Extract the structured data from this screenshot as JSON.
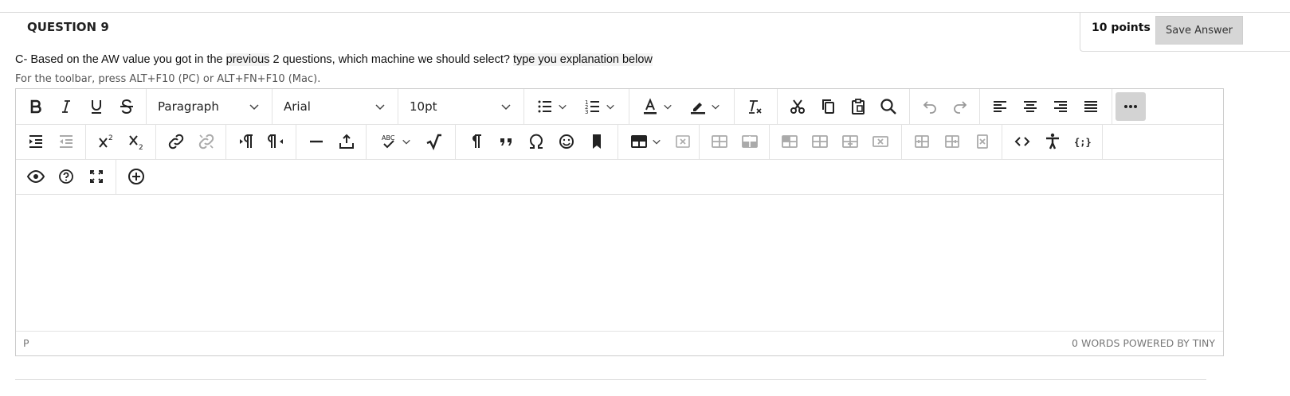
{
  "question": {
    "title": "QUESTION 9",
    "points": "10 points",
    "save_label": "Save Answer",
    "text_parts": [
      "C- Based on the AW value you got in the ",
      "previous",
      "  2 questions, which machine we should select? ",
      "type you explanation below"
    ]
  },
  "editor": {
    "hint": "For the toolbar, press ALT+F10 (PC) or ALT+FN+F10 (Mac).",
    "block_format": "Paragraph",
    "font_family": "Arial",
    "font_size": "10pt",
    "status_path": "P",
    "status_right": "0 WORDS  POWERED BY TINY",
    "icons": {
      "row1": [
        "bold-icon",
        "italic-icon",
        "underline-icon",
        "strikethrough-icon",
        "bullet-list-icon",
        "numbered-list-icon",
        "text-color-icon",
        "highlight-icon",
        "clear-formatting-icon",
        "cut-icon",
        "copy-icon",
        "paste-icon",
        "search-icon",
        "undo-icon",
        "redo-icon",
        "align-left-icon",
        "align-center-icon",
        "align-right-icon",
        "justify-icon",
        "more-icon"
      ],
      "row2": [
        "indent-icon",
        "outdent-icon",
        "superscript-icon",
        "subscript-icon",
        "link-icon",
        "unlink-icon",
        "ltr-icon",
        "rtl-icon",
        "horizontal-rule-icon",
        "insert-file-icon",
        "spellcheck-icon",
        "math-icon",
        "paragraph-mark-icon",
        "blockquote-icon",
        "omega-icon",
        "emoticon-icon",
        "bookmark-icon",
        "table-icon",
        "delete-table-icon",
        "row-before-icon",
        "row-after-icon",
        "cell-props-icon",
        "merge-cells-icon",
        "split-cell-icon",
        "delete-row-icon",
        "col-before-icon",
        "col-after-icon",
        "delete-col-icon",
        "code-icon",
        "accessibility-icon",
        "template-icon"
      ],
      "row3": [
        "preview-icon",
        "help-icon",
        "fullscreen-icon",
        "add-content-icon"
      ]
    }
  }
}
